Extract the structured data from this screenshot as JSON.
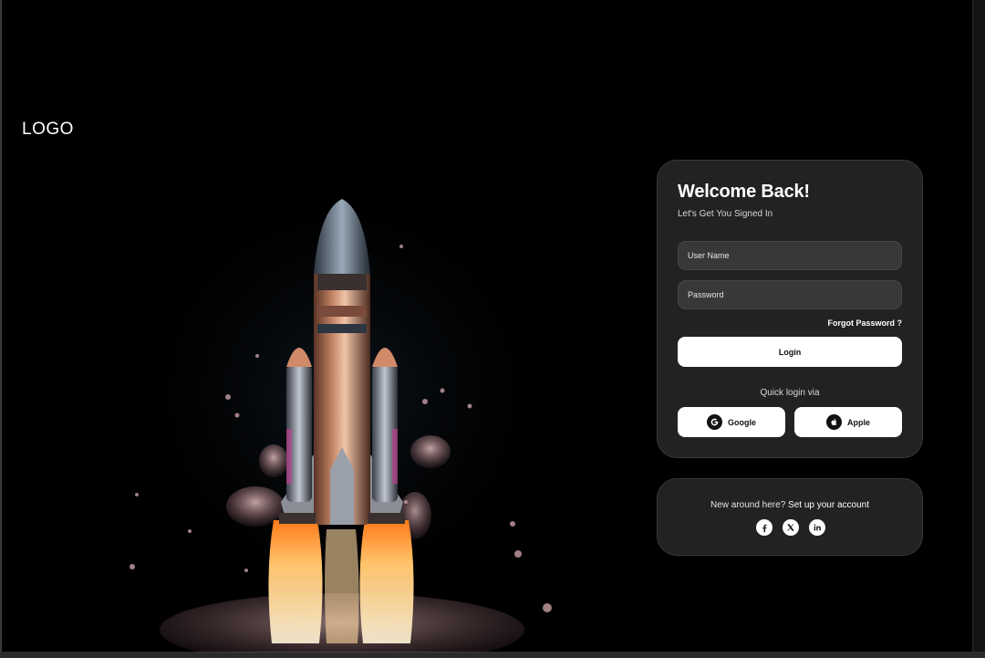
{
  "brand": {
    "logo_text": "LOGO"
  },
  "login": {
    "title": "Welcome Back!",
    "subtitle": "Let's Get You Signed In",
    "username_placeholder": "User Name",
    "password_placeholder": "Password",
    "forgot_label": "Forgot Password ?",
    "login_label": "Login",
    "quick_label": "Quick login via",
    "google_label": "Google",
    "apple_label": "Apple"
  },
  "signup": {
    "prompt": "New around here?",
    "link": "Set up your account",
    "socials": [
      "facebook-icon",
      "x-icon",
      "linkedin-icon"
    ]
  },
  "colors": {
    "background": "#000000",
    "card": "#222222",
    "field": "#383838",
    "button": "#ffffff"
  }
}
